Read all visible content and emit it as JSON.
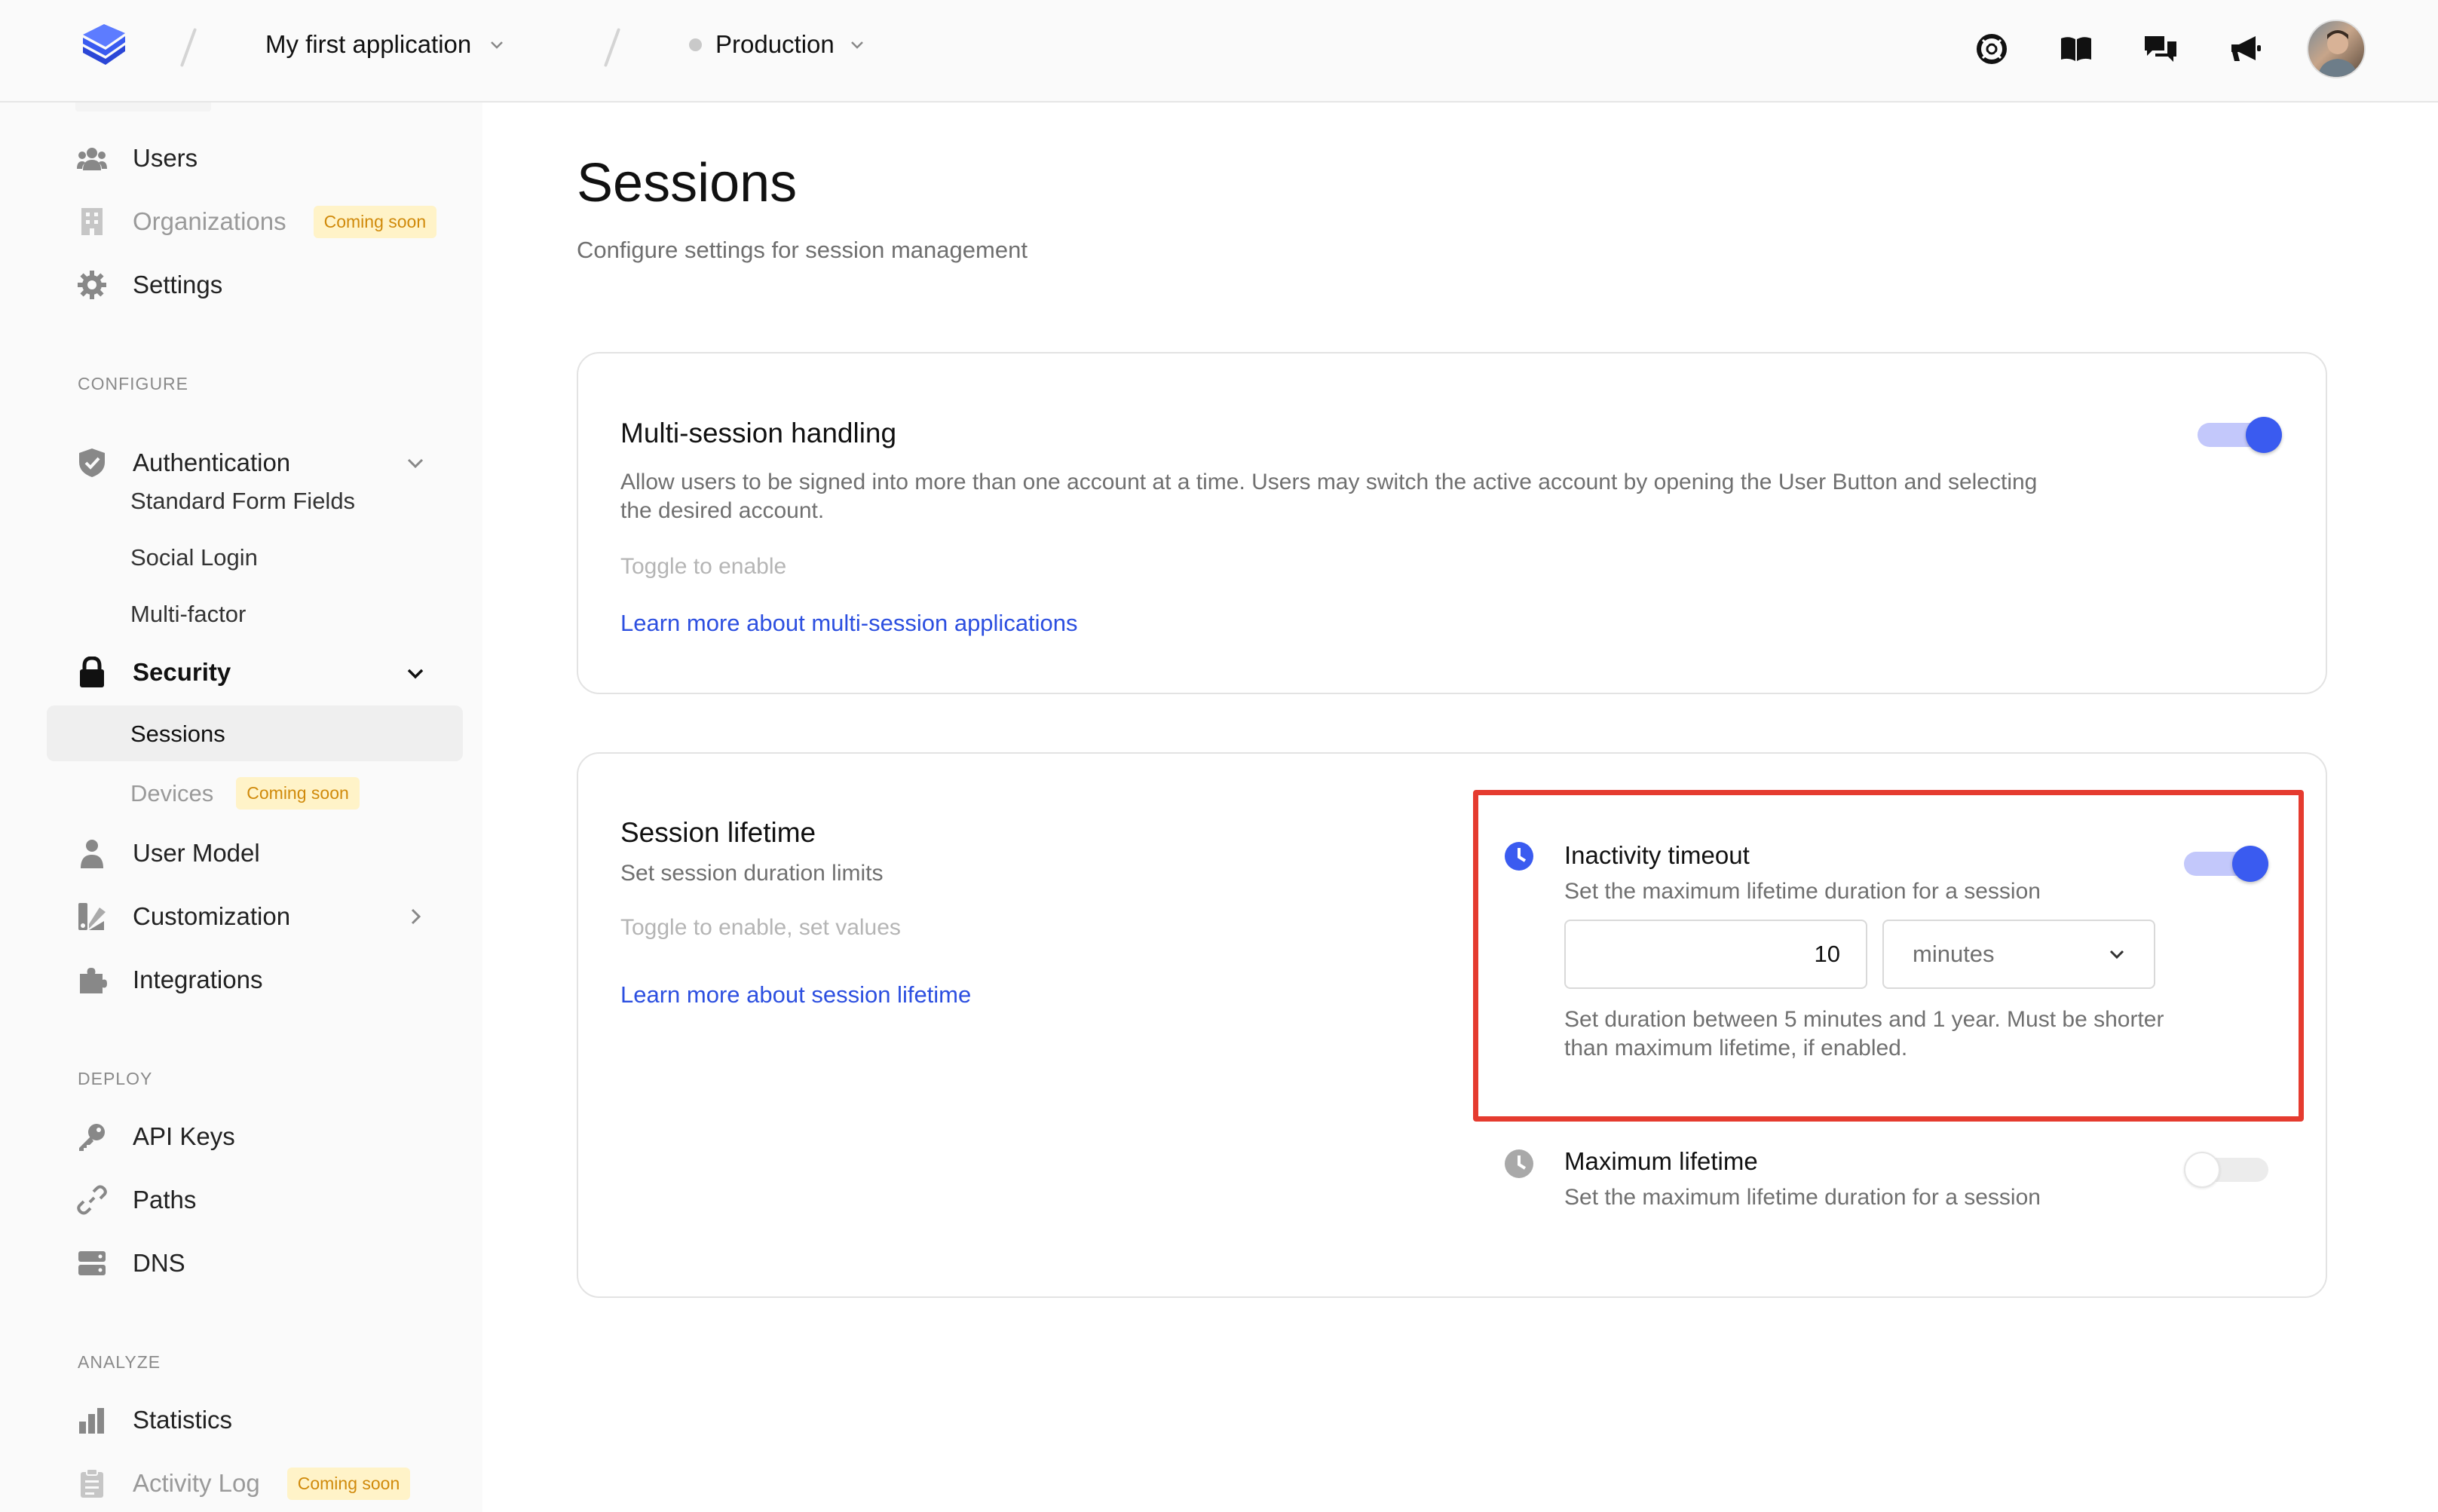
{
  "topbar": {
    "app_name": "My first application",
    "environment": "Production"
  },
  "sidebar": {
    "top_items": [
      {
        "label": "Users"
      },
      {
        "label": "Organizations",
        "badge": "Coming soon"
      },
      {
        "label": "Settings"
      }
    ],
    "configure_label": "CONFIGURE",
    "authentication": {
      "label": "Authentication",
      "children": [
        "Standard Form Fields",
        "Social Login",
        "Multi-factor"
      ]
    },
    "security": {
      "label": "Security",
      "children": [
        {
          "label": "Sessions"
        },
        {
          "label": "Devices",
          "badge": "Coming soon"
        }
      ]
    },
    "user_model": "User Model",
    "customization": "Customization",
    "integrations": "Integrations",
    "deploy_label": "DEPLOY",
    "deploy_items": [
      "API Keys",
      "Paths",
      "DNS"
    ],
    "analyze_label": "ANALYZE",
    "analyze_items": [
      {
        "label": "Statistics"
      },
      {
        "label": "Activity Log",
        "badge": "Coming soon"
      }
    ]
  },
  "page": {
    "title": "Sessions",
    "subtitle": "Configure settings for session management"
  },
  "multi_session": {
    "title": "Multi-session handling",
    "description": "Allow users to be signed into more than one account at a time. Users may switch the active account by opening the User Button and selecting the desired account.",
    "hint": "Toggle to enable",
    "link": "Learn more about multi-session applications",
    "enabled": true
  },
  "session_lifetime": {
    "title": "Session lifetime",
    "description": "Set session duration limits",
    "hint": "Toggle to enable, set values",
    "link": "Learn more about session lifetime",
    "inactivity": {
      "title": "Inactivity timeout",
      "description": "Set the maximum lifetime duration for a session",
      "value": "10",
      "unit": "minutes",
      "help": "Set duration between 5 minutes and 1 year. Must be shorter than maximum lifetime, if enabled.",
      "enabled": true
    },
    "maximum": {
      "title": "Maximum lifetime",
      "description": "Set the maximum lifetime duration for a session",
      "enabled": false
    }
  },
  "colors": {
    "accent": "#3a5bf0",
    "link": "#2c4fe0",
    "highlight": "#e53b2f",
    "badge_bg": "#fff3c8",
    "badge_text": "#d08a0b"
  }
}
